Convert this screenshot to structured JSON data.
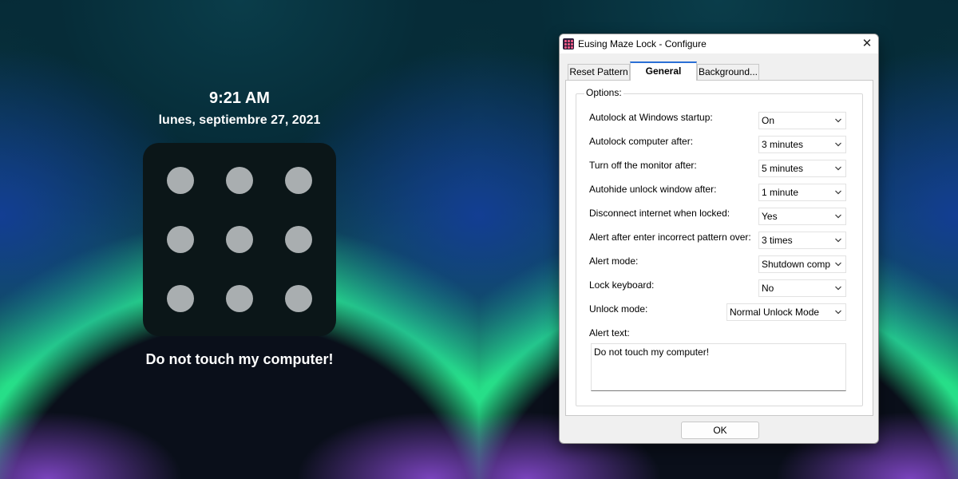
{
  "lockscreen": {
    "time": "9:21 AM",
    "date": "lunes, septiembre 27, 2021",
    "message": "Do not touch my computer!",
    "dot_count": 9
  },
  "dialog": {
    "title": "Eusing Maze Lock - Configure",
    "close_glyph": "✕",
    "tabs": [
      {
        "label": "Reset Pattern",
        "active": false
      },
      {
        "label": "General",
        "active": true
      },
      {
        "label": "Background...",
        "active": false
      }
    ],
    "group_label": "Options:",
    "options": [
      {
        "label": "Autolock at Windows startup:",
        "value": "On"
      },
      {
        "label": "Autolock computer after:",
        "value": "3 minutes"
      },
      {
        "label": "Turn off the monitor after:",
        "value": "5 minutes"
      },
      {
        "label": "Autohide unlock window after:",
        "value": "1 minute"
      },
      {
        "label": "Disconnect internet when locked:",
        "value": "Yes"
      },
      {
        "label": "Alert after enter incorrect pattern over:",
        "value": "3 times"
      },
      {
        "label": "Alert mode:",
        "value": "Shutdown comp"
      },
      {
        "label": "Lock keyboard:",
        "value": "No"
      },
      {
        "label": "Unlock mode:",
        "value": "Normal Unlock Mode"
      }
    ],
    "alert_text_label": "Alert text:",
    "alert_text_value": "Do not touch my computer!",
    "ok_label": "OK"
  },
  "icons": {
    "app": "maze-lock-app-icon",
    "close": "close-icon",
    "dropdown": "chevron-down-icon"
  },
  "colors": {
    "pad_background": "#0b1618",
    "pattern_dot": "#a9aeb0",
    "active_tab_accent": "#2b70d6",
    "app_icon_dot": "#ff5d8a"
  }
}
